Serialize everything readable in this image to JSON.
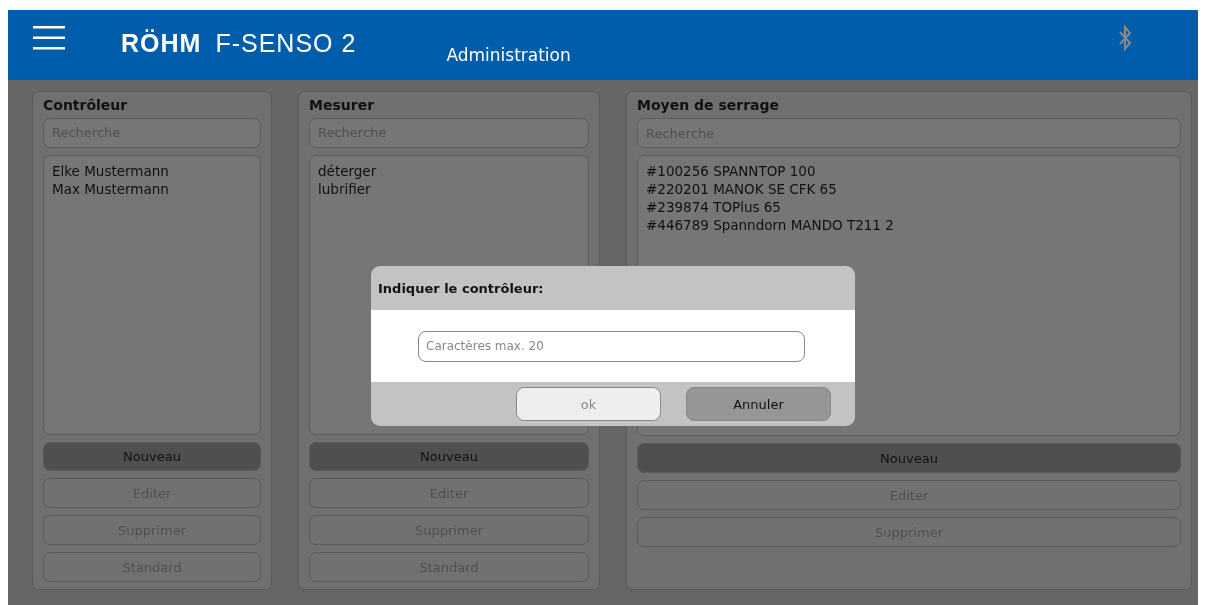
{
  "header": {
    "logo": "RÖHM",
    "product": "F-SENSO 2",
    "title": "Administration",
    "bluetooth_connected": false
  },
  "panels": [
    {
      "title": "Contrôleur",
      "search": {
        "placeholder": "Recherche"
      },
      "items": [
        "Elke Mustermann",
        "Max Mustermann"
      ],
      "buttons": [
        {
          "label": "Nouveau",
          "disabled": false
        },
        {
          "label": "Editer",
          "disabled": true
        },
        {
          "label": "Supprimer",
          "disabled": true
        },
        {
          "label": "Standard",
          "disabled": true
        }
      ]
    },
    {
      "title": "Mesurer",
      "search": {
        "placeholder": "Recherche"
      },
      "items": [
        "déterger",
        "lubrifier"
      ],
      "buttons": [
        {
          "label": "Nouveau",
          "disabled": false
        },
        {
          "label": "Editer",
          "disabled": true
        },
        {
          "label": "Supprimer",
          "disabled": true
        },
        {
          "label": "Standard",
          "disabled": true
        }
      ]
    },
    {
      "title": "Moyen de serrage",
      "search": {
        "placeholder": "Recherche"
      },
      "items": [
        "#100256 SPANNTOP 100",
        "#220201 MANOK SE CFK 65",
        "#239874 TOPlus 65",
        "#446789 Spanndorn MANDO T211 2"
      ],
      "buttons": [
        {
          "label": "Nouveau",
          "disabled": false
        },
        {
          "label": "Editer",
          "disabled": true
        },
        {
          "label": "Supprimer",
          "disabled": true
        }
      ]
    }
  ],
  "dialog": {
    "title": "Indiquer le contrôleur:",
    "field": {
      "placeholder": "Caractères max. 20"
    },
    "buttons": [
      {
        "label": "ok",
        "disabled": true
      },
      {
        "label": "Annuler",
        "disabled": false
      }
    ]
  }
}
